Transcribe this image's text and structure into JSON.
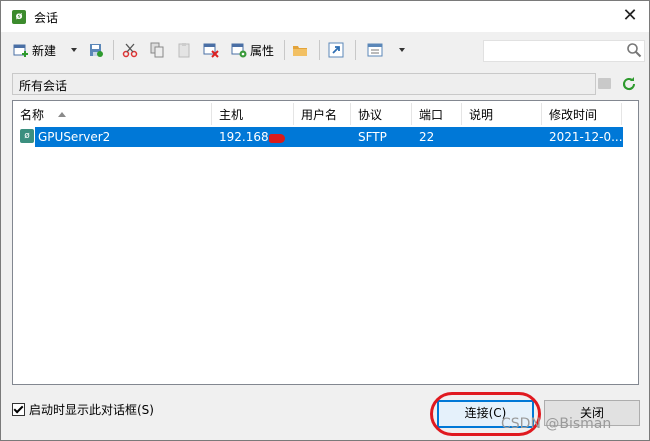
{
  "window": {
    "title": "会话",
    "close_label": "✕"
  },
  "toolbar": {
    "new_label": "新建",
    "properties_label": "属性"
  },
  "search": {
    "value": "",
    "placeholder": ""
  },
  "path": {
    "label": "所有会话"
  },
  "table": {
    "columns": [
      "名称",
      "主机",
      "用户名",
      "协议",
      "端口",
      "说明",
      "修改时间"
    ],
    "rows": [
      {
        "name": "GPUServer2",
        "host": "192.168.",
        "user": "",
        "protocol": "SFTP",
        "port": "22",
        "description": "",
        "modified": "2021-12-0..."
      }
    ]
  },
  "footer": {
    "startup_checkbox_label": "启动时显示此对话框(S)",
    "startup_checked": true,
    "connect_label": "连接(C)",
    "close_label": "关闭"
  },
  "watermark": "CSDN @Bisman",
  "colors": {
    "selection": "#0078d7",
    "highlight_ring": "#e0191f",
    "app_icon": "#3c8b2d"
  },
  "icons": [
    "app-icon",
    "new-session-icon",
    "dropdown-arrow-icon",
    "save-icon",
    "cut-icon",
    "copy-icon",
    "paste-icon",
    "delete-icon",
    "properties-icon",
    "folder-icon",
    "shortcut-icon",
    "view-icon",
    "search-icon",
    "refresh-icon",
    "session-icon"
  ]
}
